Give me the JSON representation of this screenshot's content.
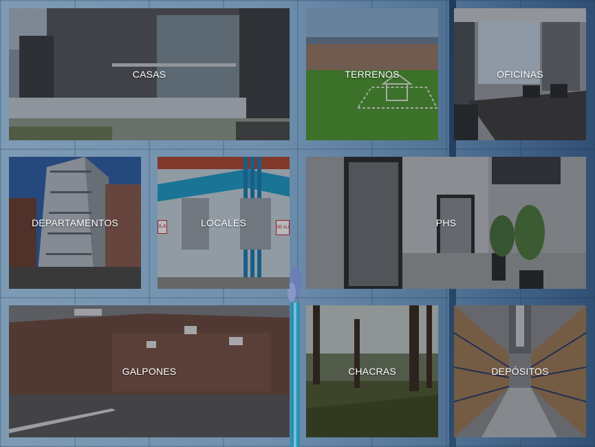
{
  "categories": [
    {
      "label": "CASAS"
    },
    {
      "label": "TERRENOS"
    },
    {
      "label": "OFICINAS"
    },
    {
      "label": "DEPARTAMENTOS"
    },
    {
      "label": "LOCALES"
    },
    {
      "label": "PHS"
    },
    {
      "label": "GALPONES"
    },
    {
      "label": "CHACRAS"
    },
    {
      "label": "DEPÓSITOS"
    }
  ],
  "storefront": {
    "sign_left": "ILA",
    "sign_right": "SE ALQ"
  }
}
